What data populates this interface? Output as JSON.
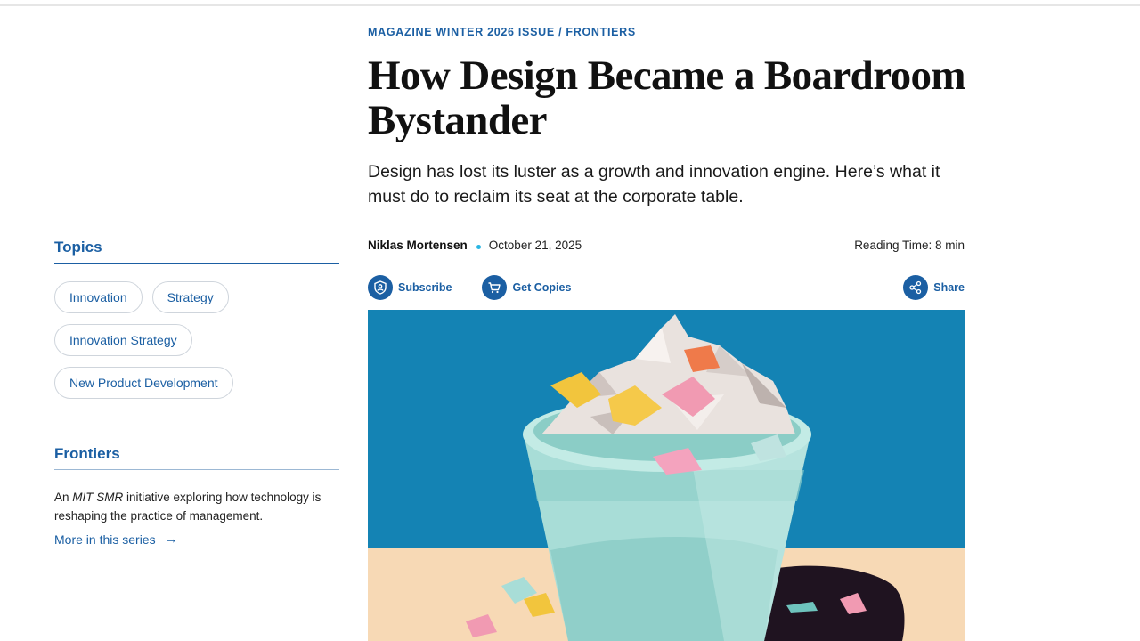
{
  "sidebar": {
    "topics_heading": "Topics",
    "topics": [
      "Innovation",
      "Strategy",
      "Innovation Strategy",
      "New Product Development"
    ],
    "series_heading": "Frontiers",
    "series_desc_prefix": "An ",
    "series_desc_em": "MIT SMR",
    "series_desc_suffix": " initiative exploring how technology is reshaping the practice of management.",
    "series_link": "More in this series",
    "series_link_arrow": "→"
  },
  "article": {
    "kicker": "MAGAZINE WINTER 2026 ISSUE / FRONTIERS",
    "title": "How Design Became a Boardroom Bystander",
    "dek": "Design has lost its luster as a growth and innovation engine. Here’s what it must do to reclaim its seat at the corporate table.",
    "author": "Niklas Mortensen",
    "date": "October 21, 2025",
    "reading_time": "Reading Time: 8 min"
  },
  "actions": {
    "subscribe": "Subscribe",
    "subscribe_icon": "shield-person-icon",
    "get_copies": "Get Copies",
    "get_copies_icon": "cart-icon",
    "share": "Share",
    "share_icon": "share-icon"
  },
  "hero": {
    "image_name": "paper-basket-illustration",
    "colors": {
      "background": "#1483b4",
      "floor": "#f7d9b5",
      "basket": "#a8ddd7",
      "shadow": "#1f1320"
    }
  },
  "colors": {
    "accent": "#1b5fa3",
    "dot": "#29b6e3"
  }
}
